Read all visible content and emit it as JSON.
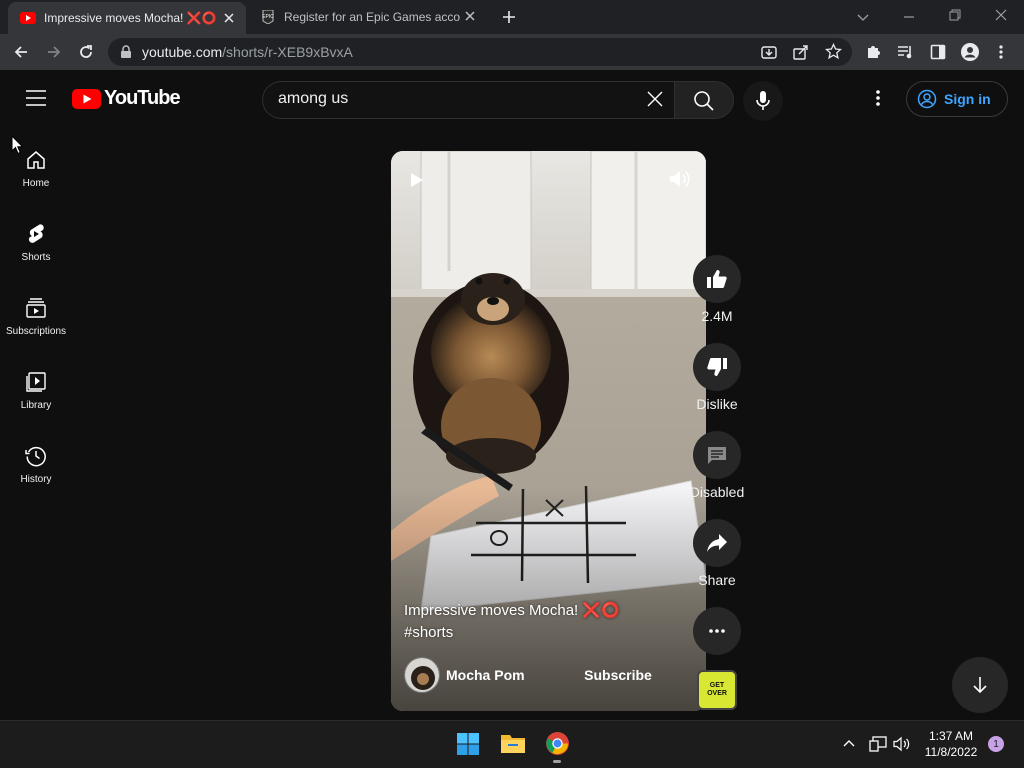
{
  "browser": {
    "tabs": [
      {
        "title": "Impressive moves Mocha! ❌⭕"
      },
      {
        "title": "Register for an Epic Games acco"
      }
    ],
    "url": {
      "host": "youtube.com",
      "path": "/shorts/r-XEB9xBvxA"
    }
  },
  "header": {
    "logo_text": "YouTube",
    "search_value": "among us",
    "signin_label": "Sign in"
  },
  "sidebar": {
    "items": [
      {
        "label": "Home",
        "icon": "home-icon"
      },
      {
        "label": "Shorts",
        "icon": "shorts-icon"
      },
      {
        "label": "Subscriptions",
        "icon": "subscriptions-icon"
      },
      {
        "label": "Library",
        "icon": "library-icon"
      },
      {
        "label": "History",
        "icon": "history-icon"
      }
    ]
  },
  "short": {
    "title_line1": "Impressive moves Mocha! ❌⭕",
    "title_line2": "#shorts",
    "channel": "Mocha Pom",
    "subscribe_label": "Subscribe",
    "actions": {
      "like_count": "2.4M",
      "dislike_label": "Dislike",
      "comments_label": "Disabled",
      "share_label": "Share"
    },
    "audio_thumb_text": "GET OVER"
  },
  "taskbar": {
    "time": "1:37 AM",
    "date": "11/8/2022",
    "notification_count": "1"
  },
  "colors": {
    "background": "#0f0f0f",
    "brand_red": "#ff0000",
    "signin_blue": "#3ea6ff"
  }
}
